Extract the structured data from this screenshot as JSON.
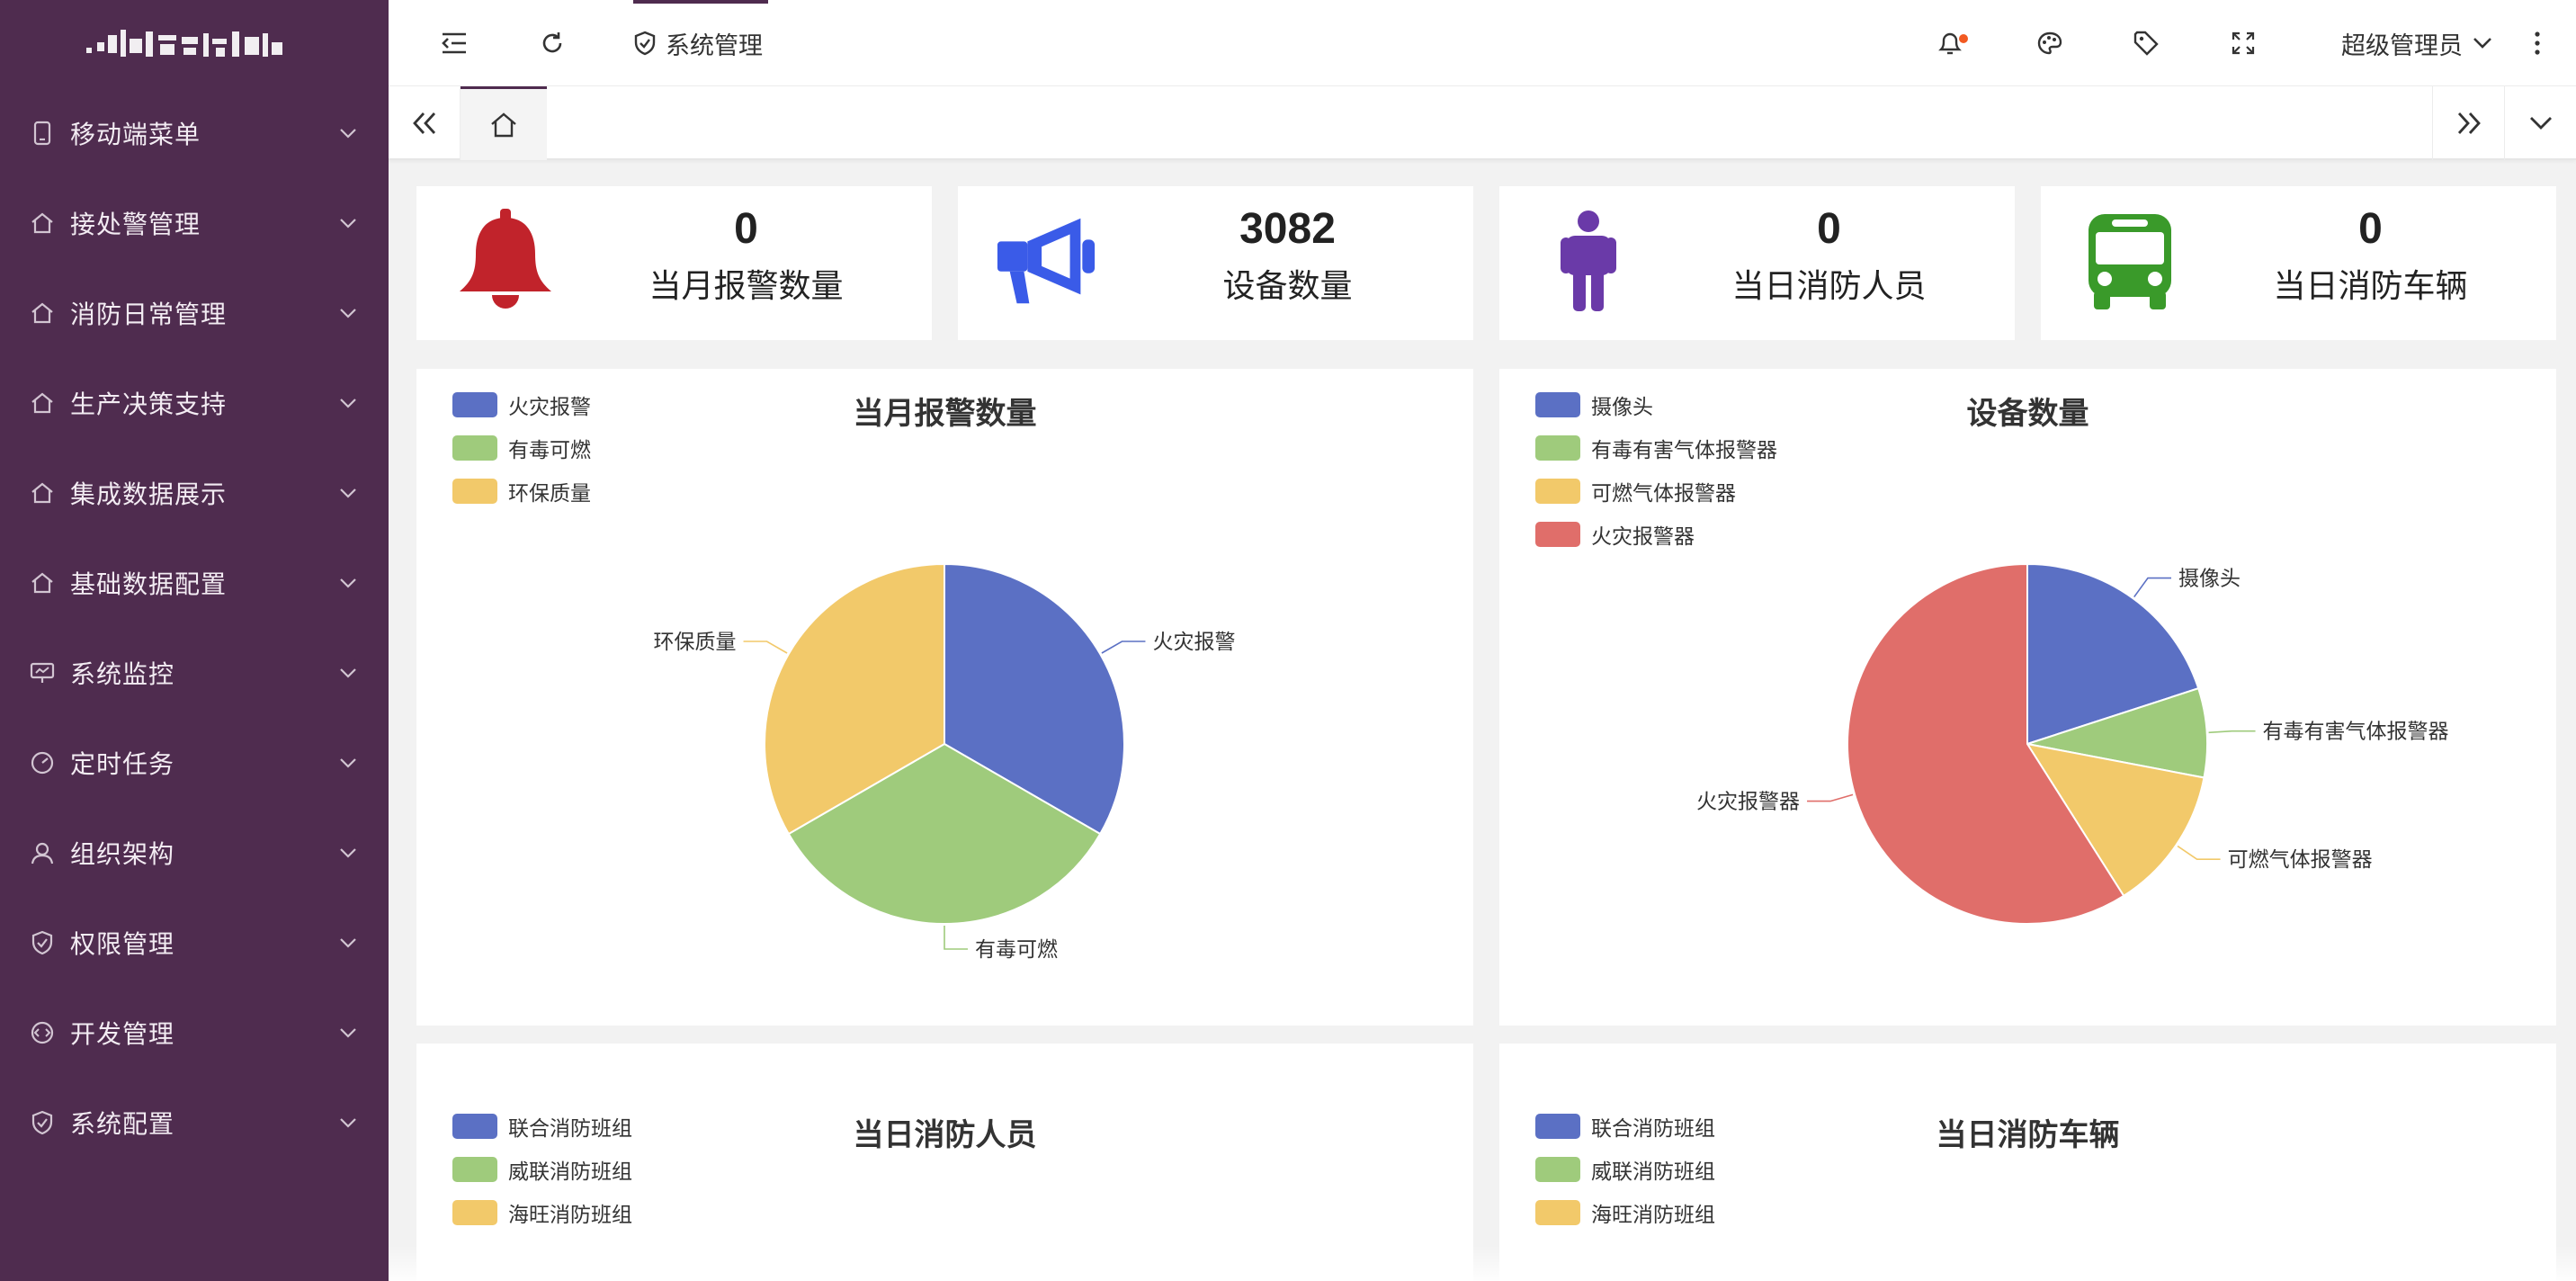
{
  "sidebar": {
    "items": [
      {
        "label": "移动端菜单",
        "icon": "phone-icon"
      },
      {
        "label": "接处警管理",
        "icon": "home-icon"
      },
      {
        "label": "消防日常管理",
        "icon": "home-icon"
      },
      {
        "label": "生产决策支持",
        "icon": "home-icon"
      },
      {
        "label": "集成数据展示",
        "icon": "home-icon"
      },
      {
        "label": "基础数据配置",
        "icon": "home-icon"
      },
      {
        "label": "系统监控",
        "icon": "monitor-icon"
      },
      {
        "label": "定时任务",
        "icon": "gauge-icon"
      },
      {
        "label": "组织架构",
        "icon": "user-icon"
      },
      {
        "label": "权限管理",
        "icon": "shield-icon"
      },
      {
        "label": "开发管理",
        "icon": "code-icon"
      },
      {
        "label": "系统配置",
        "icon": "shield-icon"
      }
    ]
  },
  "header": {
    "title": "系统管理",
    "user": "超级管理员"
  },
  "stats": [
    {
      "value": "0",
      "label": "当月报警数量",
      "icon": "bell-icon",
      "color": "#c1232b"
    },
    {
      "value": "3082",
      "label": "设备数量",
      "icon": "megaphone-icon",
      "color": "#3a5be8"
    },
    {
      "value": "0",
      "label": "当日消防人员",
      "icon": "person-icon",
      "color": "#6a3aa8"
    },
    {
      "value": "0",
      "label": "当日消防车辆",
      "icon": "bus-icon",
      "color": "#3a9a2a"
    }
  ],
  "panels": {
    "alarm": {
      "title": "当月报警数量",
      "legend": [
        "火灾报警",
        "有毒可燃",
        "环保质量"
      ]
    },
    "device": {
      "title": "设备数量",
      "legend": [
        "摄像头",
        "有毒有害气体报警器",
        "可燃气体报警器",
        "火灾报警器"
      ]
    },
    "staff": {
      "title": "当日消防人员",
      "legend": [
        "联合消防班组",
        "威联消防班组",
        "海旺消防班组"
      ]
    },
    "vehicle": {
      "title": "当日消防车辆",
      "legend": [
        "联合消防班组",
        "威联消防班组",
        "海旺消防班组"
      ]
    }
  },
  "colors": {
    "sidebar": "#4f2c4f",
    "blue": "#5b70c4",
    "green": "#9fcb7c",
    "yellow": "#f2c96a",
    "red": "#e06e6a"
  },
  "chart_data": [
    {
      "type": "pie",
      "title": "当月报警数量",
      "categories": [
        "火灾报警",
        "有毒可燃",
        "环保质量"
      ],
      "values": [
        1,
        1,
        1
      ],
      "colors": [
        "#5b70c4",
        "#9fcb7c",
        "#f2c96a"
      ]
    },
    {
      "type": "pie",
      "title": "设备数量",
      "categories": [
        "摄像头",
        "有毒有害气体报警器",
        "可燃气体报警器",
        "火灾报警器"
      ],
      "values": [
        20,
        8,
        13,
        59
      ],
      "colors": [
        "#5b70c4",
        "#9fcb7c",
        "#f2c96a",
        "#e06e6a"
      ]
    }
  ]
}
